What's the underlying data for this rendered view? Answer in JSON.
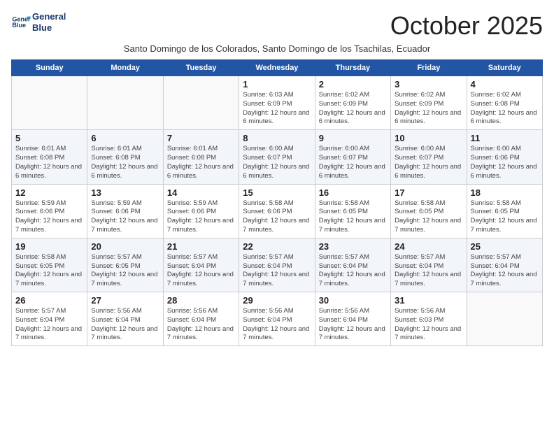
{
  "logo": {
    "line1": "General",
    "line2": "Blue"
  },
  "title": "October 2025",
  "subtitle": "Santo Domingo de los Colorados, Santo Domingo de los Tsachilas, Ecuador",
  "days_of_week": [
    "Sunday",
    "Monday",
    "Tuesday",
    "Wednesday",
    "Thursday",
    "Friday",
    "Saturday"
  ],
  "weeks": [
    [
      {
        "day": "",
        "info": ""
      },
      {
        "day": "",
        "info": ""
      },
      {
        "day": "",
        "info": ""
      },
      {
        "day": "1",
        "info": "Sunrise: 6:03 AM\nSunset: 6:09 PM\nDaylight: 12 hours and 6 minutes."
      },
      {
        "day": "2",
        "info": "Sunrise: 6:02 AM\nSunset: 6:09 PM\nDaylight: 12 hours and 6 minutes."
      },
      {
        "day": "3",
        "info": "Sunrise: 6:02 AM\nSunset: 6:09 PM\nDaylight: 12 hours and 6 minutes."
      },
      {
        "day": "4",
        "info": "Sunrise: 6:02 AM\nSunset: 6:08 PM\nDaylight: 12 hours and 6 minutes."
      }
    ],
    [
      {
        "day": "5",
        "info": "Sunrise: 6:01 AM\nSunset: 6:08 PM\nDaylight: 12 hours and 6 minutes."
      },
      {
        "day": "6",
        "info": "Sunrise: 6:01 AM\nSunset: 6:08 PM\nDaylight: 12 hours and 6 minutes."
      },
      {
        "day": "7",
        "info": "Sunrise: 6:01 AM\nSunset: 6:08 PM\nDaylight: 12 hours and 6 minutes."
      },
      {
        "day": "8",
        "info": "Sunrise: 6:00 AM\nSunset: 6:07 PM\nDaylight: 12 hours and 6 minutes."
      },
      {
        "day": "9",
        "info": "Sunrise: 6:00 AM\nSunset: 6:07 PM\nDaylight: 12 hours and 6 minutes."
      },
      {
        "day": "10",
        "info": "Sunrise: 6:00 AM\nSunset: 6:07 PM\nDaylight: 12 hours and 6 minutes."
      },
      {
        "day": "11",
        "info": "Sunrise: 6:00 AM\nSunset: 6:06 PM\nDaylight: 12 hours and 6 minutes."
      }
    ],
    [
      {
        "day": "12",
        "info": "Sunrise: 5:59 AM\nSunset: 6:06 PM\nDaylight: 12 hours and 7 minutes."
      },
      {
        "day": "13",
        "info": "Sunrise: 5:59 AM\nSunset: 6:06 PM\nDaylight: 12 hours and 7 minutes."
      },
      {
        "day": "14",
        "info": "Sunrise: 5:59 AM\nSunset: 6:06 PM\nDaylight: 12 hours and 7 minutes."
      },
      {
        "day": "15",
        "info": "Sunrise: 5:58 AM\nSunset: 6:06 PM\nDaylight: 12 hours and 7 minutes."
      },
      {
        "day": "16",
        "info": "Sunrise: 5:58 AM\nSunset: 6:05 PM\nDaylight: 12 hours and 7 minutes."
      },
      {
        "day": "17",
        "info": "Sunrise: 5:58 AM\nSunset: 6:05 PM\nDaylight: 12 hours and 7 minutes."
      },
      {
        "day": "18",
        "info": "Sunrise: 5:58 AM\nSunset: 6:05 PM\nDaylight: 12 hours and 7 minutes."
      }
    ],
    [
      {
        "day": "19",
        "info": "Sunrise: 5:58 AM\nSunset: 6:05 PM\nDaylight: 12 hours and 7 minutes."
      },
      {
        "day": "20",
        "info": "Sunrise: 5:57 AM\nSunset: 6:05 PM\nDaylight: 12 hours and 7 minutes."
      },
      {
        "day": "21",
        "info": "Sunrise: 5:57 AM\nSunset: 6:04 PM\nDaylight: 12 hours and 7 minutes."
      },
      {
        "day": "22",
        "info": "Sunrise: 5:57 AM\nSunset: 6:04 PM\nDaylight: 12 hours and 7 minutes."
      },
      {
        "day": "23",
        "info": "Sunrise: 5:57 AM\nSunset: 6:04 PM\nDaylight: 12 hours and 7 minutes."
      },
      {
        "day": "24",
        "info": "Sunrise: 5:57 AM\nSunset: 6:04 PM\nDaylight: 12 hours and 7 minutes."
      },
      {
        "day": "25",
        "info": "Sunrise: 5:57 AM\nSunset: 6:04 PM\nDaylight: 12 hours and 7 minutes."
      }
    ],
    [
      {
        "day": "26",
        "info": "Sunrise: 5:57 AM\nSunset: 6:04 PM\nDaylight: 12 hours and 7 minutes."
      },
      {
        "day": "27",
        "info": "Sunrise: 5:56 AM\nSunset: 6:04 PM\nDaylight: 12 hours and 7 minutes."
      },
      {
        "day": "28",
        "info": "Sunrise: 5:56 AM\nSunset: 6:04 PM\nDaylight: 12 hours and 7 minutes."
      },
      {
        "day": "29",
        "info": "Sunrise: 5:56 AM\nSunset: 6:04 PM\nDaylight: 12 hours and 7 minutes."
      },
      {
        "day": "30",
        "info": "Sunrise: 5:56 AM\nSunset: 6:04 PM\nDaylight: 12 hours and 7 minutes."
      },
      {
        "day": "31",
        "info": "Sunrise: 5:56 AM\nSunset: 6:03 PM\nDaylight: 12 hours and 7 minutes."
      },
      {
        "day": "",
        "info": ""
      }
    ]
  ]
}
